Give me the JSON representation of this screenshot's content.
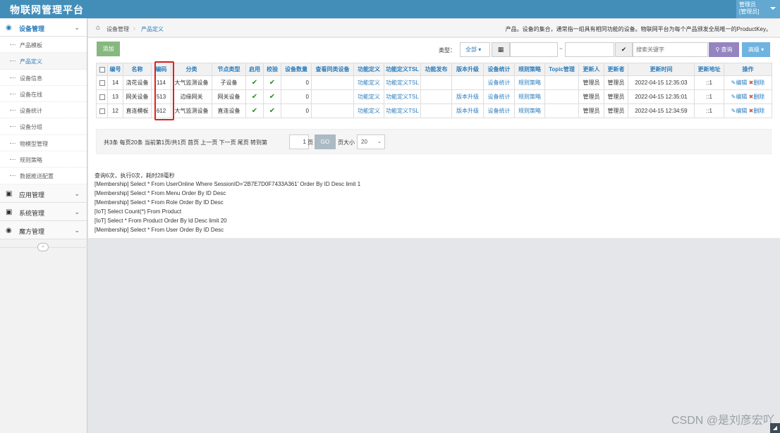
{
  "app": {
    "title": "物联网管理平台"
  },
  "user": {
    "name": "管理员",
    "role": "[管理员]"
  },
  "sidebar": {
    "groups": [
      {
        "label": "设备管理",
        "icon": "dashboard-icon",
        "expanded": true,
        "items": [
          "产品模板",
          "产品定义",
          "设备信息",
          "设备在线",
          "设备统计",
          "设备分组",
          "物模型管理",
          "规则策略",
          "数据推送配置"
        ]
      },
      {
        "label": "应用管理",
        "icon": "desktop-icon"
      },
      {
        "label": "系统管理",
        "icon": "desktop-icon"
      },
      {
        "label": "魔方管理",
        "icon": "dashboard-icon"
      }
    ],
    "collapse_glyph": "«"
  },
  "breadcrumb": {
    "home_icon": "home-icon",
    "level1": "设备管理",
    "level2": "产品定义",
    "separator": "›",
    "description": "产品。设备的集合，通常指一组具有相同功能的设备。物联网平台为每个产品颁发全局唯一的ProductKey。"
  },
  "toolbar": {
    "add_label": "添加",
    "type_label": "类型：",
    "type_value": "全部",
    "date_tilde": "~",
    "search_placeholder": "搜索关键字",
    "query_label": "查询",
    "advanced_label": "高级"
  },
  "table": {
    "headers": [
      "编号",
      "名称",
      "编码",
      "分类",
      "节点类型",
      "启用",
      "校验",
      "设备数量",
      "查看同类设备",
      "功能定义",
      "功能定义TSL",
      "功能发布",
      "版本升级",
      "设备统计",
      "规则策略",
      "Topic管理",
      "更新人",
      "更新者",
      "更新时间",
      "更新地址",
      "操作"
    ],
    "rows": [
      {
        "id": "14",
        "name": "浇花设备",
        "code": "114",
        "category": "大气监测设备",
        "node_type": "子设备",
        "count": "0",
        "func_def": "功能定义",
        "func_tsl": "功能定义TSL",
        "upgrade": "",
        "stat": "设备统计",
        "rule": "规则策略",
        "updater1": "管理员",
        "updater2": "管理员",
        "time": "2022-04-15 12:35:03",
        "addr": "::1",
        "edit": "编辑",
        "del": "删除"
      },
      {
        "id": "13",
        "name": "网关设备",
        "code": "513",
        "category": "边缘网关",
        "node_type": "网关设备",
        "count": "0",
        "func_def": "功能定义",
        "func_tsl": "功能定义TSL",
        "upgrade": "版本升级",
        "stat": "设备统计",
        "rule": "规则策略",
        "updater1": "管理员",
        "updater2": "管理员",
        "time": "2022-04-15 12:35:01",
        "addr": "::1",
        "edit": "编辑",
        "del": "删除"
      },
      {
        "id": "12",
        "name": "直连模板",
        "code": "612",
        "category": "大气监测设备",
        "node_type": "直连设备",
        "count": "0",
        "func_def": "功能定义",
        "func_tsl": "功能定义TSL",
        "upgrade": "版本升级",
        "stat": "设备统计",
        "rule": "规则策略",
        "updater1": "管理员",
        "updater2": "管理员",
        "time": "2022-04-15 12:34:59",
        "addr": "::1",
        "edit": "编辑",
        "del": "删除"
      }
    ]
  },
  "pager": {
    "summary": "共3条  每页20条  当前第1页/共1页  首页  上一页  下一页  尾页  转到第",
    "page_value": "1",
    "page_suffix": "页",
    "go_label": "GO",
    "size_label": "页大小",
    "size_value": "20"
  },
  "log": [
    "查询6次，执行0次，耗时28毫秒",
    "[Membership] Select * From UserOnline Where SessionID='2B7E7D0F7433A361' Order By ID Desc limit 1",
    "[Membership] Select * From Menu Order By ID Desc",
    "[Membership] Select * From Role Order By ID Desc",
    "[IoT] Select Count(*) From Product",
    "[IoT] Select * From Product Order By Id Desc limit 20",
    "[Membership] Select * From User Order By ID Desc"
  ],
  "watermark": "CSDN @是刘彦宏吖",
  "colors": {
    "navbar": "#438eb9",
    "link": "#2b7dbc",
    "add_button": "#87b87f",
    "query_button": "#9585bf",
    "highlight": "#e02020"
  }
}
